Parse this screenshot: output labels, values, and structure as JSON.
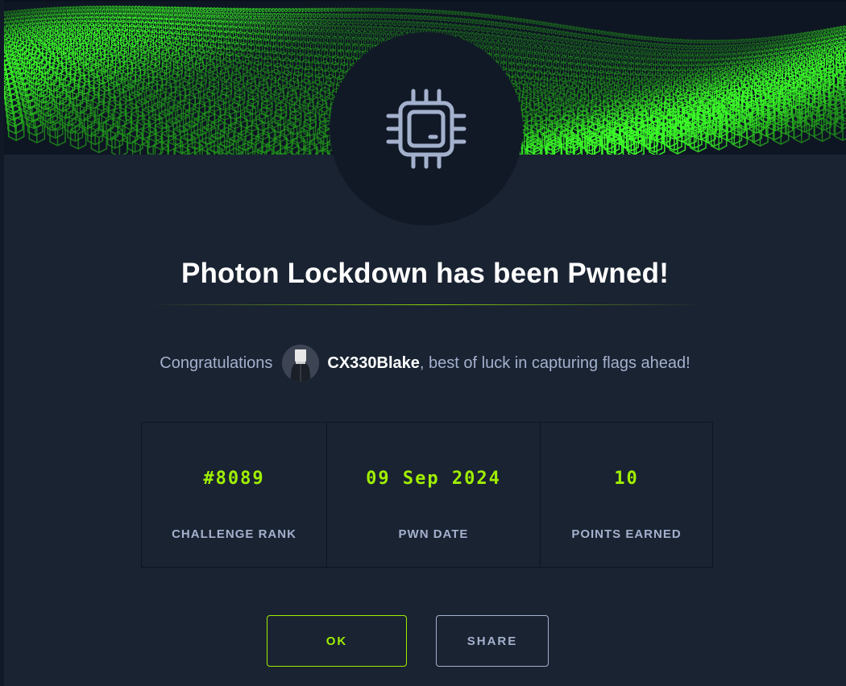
{
  "modal": {
    "title": "Photon Lockdown has been Pwned!",
    "congrats_prefix": "Congratulations",
    "username": "CX330Blake",
    "congrats_suffix": ", best of luck in capturing flags ahead!"
  },
  "stats": [
    {
      "value": "#8089",
      "label": "CHALLENGE RANK"
    },
    {
      "value": "09 Sep 2024",
      "label": "PWN DATE"
    },
    {
      "value": "10",
      "label": "POINTS EARNED"
    }
  ],
  "buttons": {
    "ok_label": "OK",
    "share_label": "SHARE"
  },
  "icons": {
    "badge": "cpu-chip-icon",
    "avatar": "user-avatar"
  },
  "colors": {
    "accent": "#9fef00",
    "background": "#1a2332",
    "badge_bg": "#111927",
    "muted_text": "#a4b1cd",
    "banner_cube": "#22c01a"
  }
}
